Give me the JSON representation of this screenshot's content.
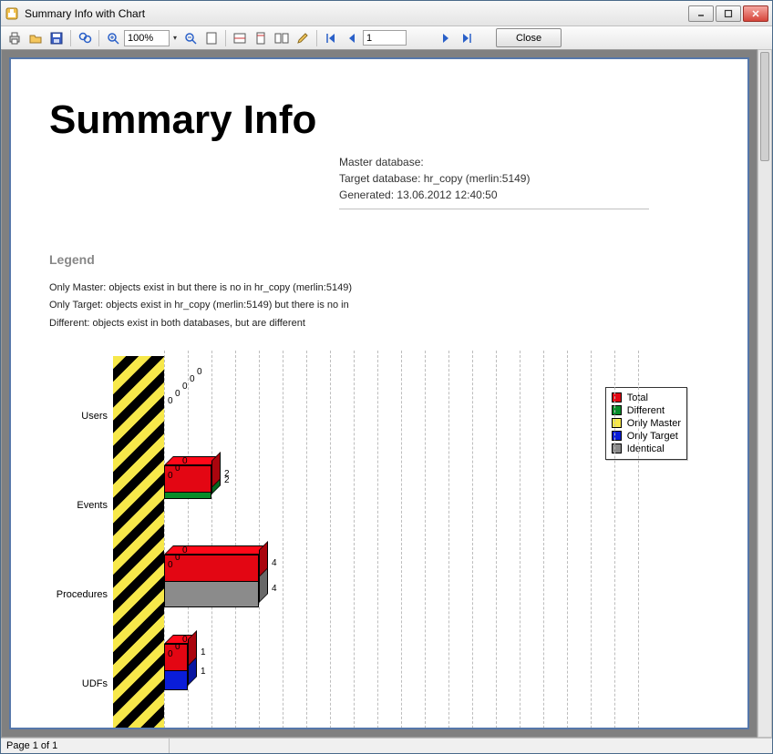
{
  "window": {
    "title": "Summary Info with Chart"
  },
  "toolbar": {
    "zoom": "100%",
    "page_input": "1",
    "close_label": "Close"
  },
  "statusbar": {
    "page_text": "Page 1 of 1"
  },
  "document": {
    "heading": "Summary Info",
    "meta": {
      "master_label": "Master database:",
      "master_value": "",
      "target_label": "Target database:",
      "target_value": "hr_copy (merlin:5149)",
      "generated_label": "Generated:",
      "generated_value": "13.06.2012 12:40:50"
    },
    "legend_title": "Legend",
    "legend_lines": {
      "only_master": "Only Master: objects exist in  but there is no in hr_copy (merlin:5149)",
      "only_target": "Only Target: objects exist in hr_copy (merlin:5149) but there is no in",
      "different": "Different:  objects exist in both databases, but are different"
    }
  },
  "chart_legend": {
    "total": "Total",
    "different": "Different",
    "only_master": "Only Master",
    "only_target": "Only Target",
    "identical": "Identical"
  },
  "chart_colors": {
    "total": "#e30613",
    "different": "#078c2a",
    "only_master": "#f7e84a",
    "only_target": "#0a1dd8",
    "identical": "#8b8b8b"
  },
  "chart_data": {
    "type": "bar",
    "orientation": "horizontal",
    "stacked": false,
    "categories": [
      "Users",
      "Events",
      "Procedures",
      "UDFs"
    ],
    "series": [
      {
        "name": "Total",
        "color_key": "total",
        "values": [
          0,
          2,
          4,
          1
        ]
      },
      {
        "name": "Different",
        "color_key": "different",
        "values": [
          0,
          2,
          0,
          0
        ]
      },
      {
        "name": "Only Master",
        "color_key": "only_master",
        "values": [
          0,
          0,
          0,
          0
        ]
      },
      {
        "name": "Only Target",
        "color_key": "only_target",
        "values": [
          0,
          0,
          0,
          1
        ]
      },
      {
        "name": "Identical",
        "color_key": "identical",
        "values": [
          0,
          0,
          4,
          0
        ]
      }
    ],
    "xlim": [
      0,
      20
    ],
    "grid_step": 1,
    "title": "",
    "ylabel": "",
    "xlabel": ""
  }
}
